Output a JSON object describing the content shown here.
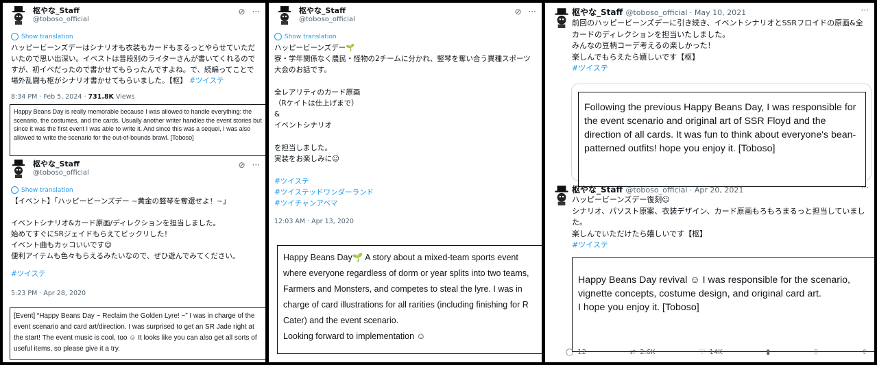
{
  "left": {
    "tweet1": {
      "name": "枢やな_Staff",
      "handle": "@toboso_official",
      "show_translation": "Show translation",
      "text": "ハッピービーンズデーはシナリオも衣装もカードもまるっとやらせていただいたので思い出深い。イベストは普段別のライターさんが書いてくれるのですが、初イベだったので書かせてもらったんですよね。で、続編ってことで場外乱闘も枢がシナリオ書かせてもらいました。【枢】 ",
      "hashtag": "#ツイステ",
      "time": "8:34 PM · Feb 5, 2024 · ",
      "views_count": "731.8K",
      "views_label": " Views",
      "translation": "Happy Beans Day is really memorable because I was allowed to handle everything: the scenario, the costumes, and the cards. Usually another writer handles the event stories but since it was the first event I was able to write it. And since this was a sequel, I was also allowed to write the scenario for the out-of-bounds brawl. [Toboso]"
    },
    "tweet2": {
      "name": "枢やな_Staff",
      "handle": "@toboso_official",
      "show_translation": "Show translation",
      "text": "【イベント】「ハッピービーンズデー ~黄金の竪琴を奪還せよ！~」\n\nイベントシナリオ&カード原画/ディレクションを担当しました。\n始めてすぐにSRジェイドもらえてビックリした！\nイベント曲もカッコいいです☺\n便利アイテムも色々もらえるみたいなので、ぜひ遊んでみてください。",
      "hashtag": "#ツイステ",
      "time": "5:23 PM · Apr 28, 2020",
      "translation": "[Event] “Happy Beans Day ~ Reclaim the Golden Lyre! ~” I was in charge of the event scenario and card art/direction. I was surprised to get an SR Jade right at the start! The event music is cool, too ☺ It looks like you can also get all sorts of useful items, so please give it a try."
    }
  },
  "middle": {
    "name": "枢やな_Staff",
    "handle": "@toboso_official",
    "show_translation": "Show translation",
    "text": "ハッピービーンズデー🌱\n寮・学年関係なく農民・怪物の2チームに分かれ、竪琴を奪い合う異種スポーツ大会のお話です。\n\n全レアリティのカード原画\n（Rケイトは仕上げまで）\n&\nイベントシナリオ\n\nを担当しました。\n実装をお楽しみに☺",
    "hashtags": [
      "#ツイステ",
      "#ツイステッドワンダーランド",
      "#ツイチャンアベマ"
    ],
    "time": "12:03 AM · Apr 13, 2020",
    "translation": "Happy Beans Day🌱 A story about a mixed-team sports event where everyone regardless of dorm or year splits into two teams, Farmers and Monsters, and competes to steal the lyre. I was in charge of card illustrations for all rarities (including finishing for R Cater) and the event scenario.\nLooking forward to implementation ☺"
  },
  "right": {
    "tweet1": {
      "name": "枢やな_Staff",
      "handle_date": "@toboso_official · May 10, 2021",
      "text": "前回のハッピービーンズデーに引き続き、イベントシナリオとSSRフロイドの原画&全カードのディレクションを担当いたしました。\nみんなの豆柄コーデ考えるの楽しかった！\n楽しんでもらえたら嬉しいです【枢】",
      "hashtag": "#ツイステ",
      "translation": "Following the previous Happy Beans Day, I was responsible for the event scenario and original art of SSR Floyd and the direction of all cards. It was fun to think about everyone's bean-patterned outfits! hope you enjoy it. [Toboso]"
    },
    "tweet2": {
      "name": "枢やな_Staff",
      "handle_date": "@toboso_official · Apr 20, 2021",
      "text": "ハッピービーンズデー復刻☺\nシナリオ、パソスト原案、衣装デザイン、カード原画もろもろまるっと担当していました。\n楽しんでいただけたら嬉しいです【枢】",
      "hashtag": "#ツイステ",
      "translation": "Happy Beans Day revival ☺ I was responsible for the scenario, vignette concepts, costume design, and original card art.\nI hope you enjoy it. [Toboso]",
      "actions": {
        "replies": "12",
        "retweets": "2.6K",
        "likes": "14K"
      }
    }
  },
  "colors": {
    "link": "#1d9bf0",
    "muted": "#536471"
  },
  "icons": [
    "grok-icon",
    "more-icon",
    "globe-icon",
    "reply-icon",
    "retweet-icon",
    "like-icon",
    "views-icon",
    "bookmark-icon",
    "share-icon"
  ]
}
